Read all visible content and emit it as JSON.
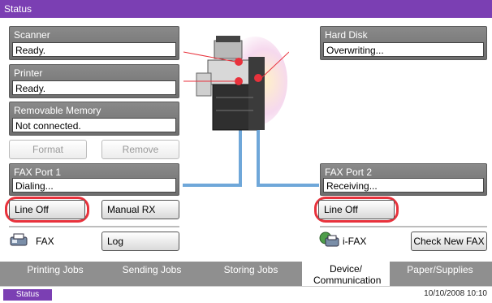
{
  "window": {
    "title": "Status"
  },
  "groups": {
    "scanner": {
      "label": "Scanner",
      "value": "Ready."
    },
    "printer": {
      "label": "Printer",
      "value": "Ready."
    },
    "removable": {
      "label": "Removable Memory",
      "value": "Not connected."
    },
    "harddisk": {
      "label": "Hard Disk",
      "value": "Overwriting..."
    },
    "fax1": {
      "label": "FAX Port 1",
      "value": "Dialing..."
    },
    "fax2": {
      "label": "FAX Port 2",
      "value": "Receiving..."
    }
  },
  "buttons": {
    "format": "Format",
    "remove": "Remove",
    "line_off_1": "Line Off",
    "manual_rx": "Manual RX",
    "line_off_2": "Line Off",
    "log": "Log",
    "check_new_fax": "Check New FAX"
  },
  "labels": {
    "fax": "FAX",
    "ifax": "i-FAX"
  },
  "tabs": [
    {
      "label": "Printing Jobs"
    },
    {
      "label": "Sending Jobs"
    },
    {
      "label": "Storing Jobs"
    },
    {
      "label": "Device/ Communication"
    },
    {
      "label": "Paper/Supplies"
    }
  ],
  "statusbar": {
    "button": "Status",
    "datetime": "10/10/2008  10:10"
  },
  "colors": {
    "title_bg": "#7b3fb3",
    "highlight": "#e8323c",
    "pipe": "#6fa7d9"
  }
}
